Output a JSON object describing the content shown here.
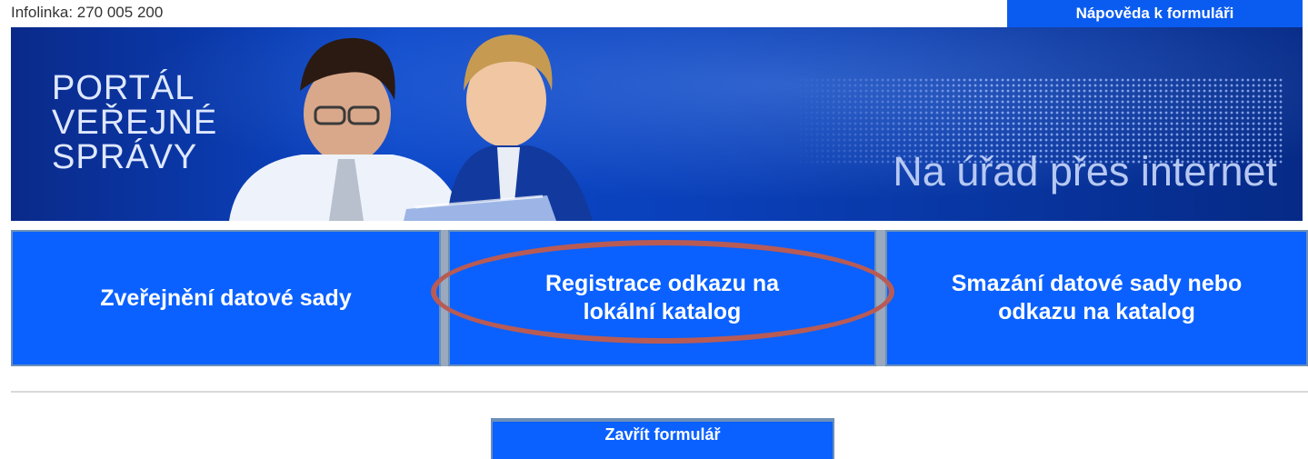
{
  "header": {
    "infolinka": "Infolinka: 270 005 200",
    "help_label": "Nápověda k formuláři"
  },
  "banner": {
    "title_lines": [
      "PORTÁL",
      "VEŘEJNÉ",
      "SPRÁVY"
    ],
    "slogan": "Na úřad přes internet",
    "colors": {
      "background": "#0b47c9",
      "title": "#dfe8ff",
      "slogan": "#b6c8f2"
    }
  },
  "actions": {
    "tiles": [
      {
        "lines": [
          "Zveřejnění datové sady"
        ]
      },
      {
        "lines": [
          "Registrace odkazu na",
          "lokální katalog"
        ],
        "highlighted": true
      },
      {
        "lines": [
          "Smazání datové sady nebo",
          "odkazu na katalog"
        ]
      }
    ],
    "highlight_color": "#b85b55"
  },
  "footer": {
    "close_label": "Zavřít formulář"
  },
  "colors": {
    "accent": "#0a61ff",
    "header_button": "#0a5cf0"
  }
}
